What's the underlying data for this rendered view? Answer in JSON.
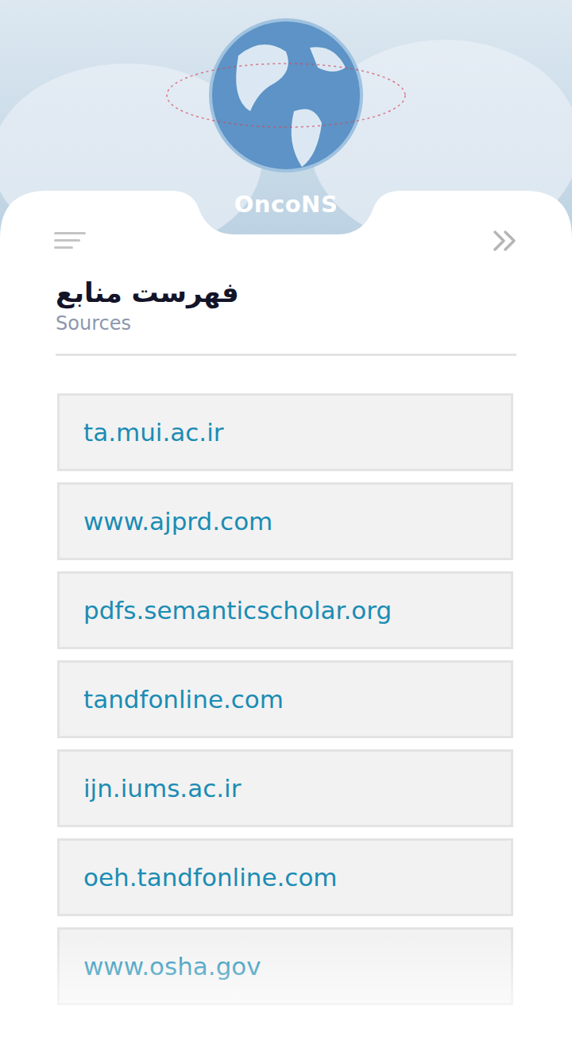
{
  "header": {
    "brand": "OncoNS"
  },
  "page": {
    "title": "فهرست منابع",
    "subtitle": "Sources"
  },
  "sources": [
    "ta.mui.ac.ir",
    "www.ajprd.com",
    "pdfs.semanticscholar.org",
    "tandfonline.com",
    "ijn.iums.ac.ir",
    "oeh.tandfonline.com",
    "www.osha.gov"
  ]
}
